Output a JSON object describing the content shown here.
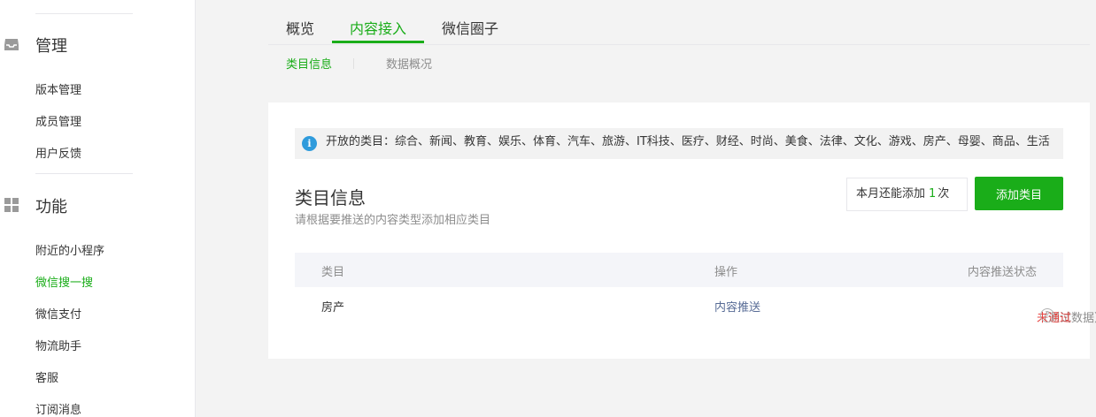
{
  "sidebar": {
    "management": {
      "title": "管理",
      "icon": "inbox-icon",
      "items": [
        {
          "label": "版本管理"
        },
        {
          "label": "成员管理"
        },
        {
          "label": "用户反馈"
        }
      ]
    },
    "features": {
      "title": "功能",
      "icon": "grid-icon",
      "items": [
        {
          "label": "附近的小程序"
        },
        {
          "label": "微信搜一搜",
          "active": true
        },
        {
          "label": "微信支付"
        },
        {
          "label": "物流助手"
        },
        {
          "label": "客服"
        },
        {
          "label": "订阅消息"
        }
      ]
    }
  },
  "tabs": [
    {
      "label": "概览"
    },
    {
      "label": "内容接入",
      "active": true
    },
    {
      "label": "微信圈子"
    }
  ],
  "subtabs": [
    {
      "label": "类目信息",
      "active": true
    },
    {
      "label": "数据概况"
    }
  ],
  "notice": {
    "icon": "info-icon",
    "text": "开放的类目：综合、新闻、教育、娱乐、体育、汽车、旅游、IT科技、医疗、财经、时尚、美食、法律、文化、游戏、房产、母婴、商品、生活"
  },
  "category_section": {
    "title": "类目信息",
    "description": "请根据要推送的内容类型添加相应类目",
    "quota_prefix": "本月还能添加",
    "quota_count": "1",
    "quota_suffix": "次",
    "add_button": "添加类目"
  },
  "table": {
    "headers": {
      "category": "类目",
      "operation": "操作",
      "status": "内容推送状态"
    },
    "rows": [
      {
        "category": "房产",
        "operation": "内容推送",
        "status_note": "（测试数据）",
        "status": "未通过"
      }
    ]
  },
  "colors": {
    "accent": "#1aad19",
    "link": "#576b95",
    "error": "#e64340",
    "info": "#2f9bdc"
  }
}
